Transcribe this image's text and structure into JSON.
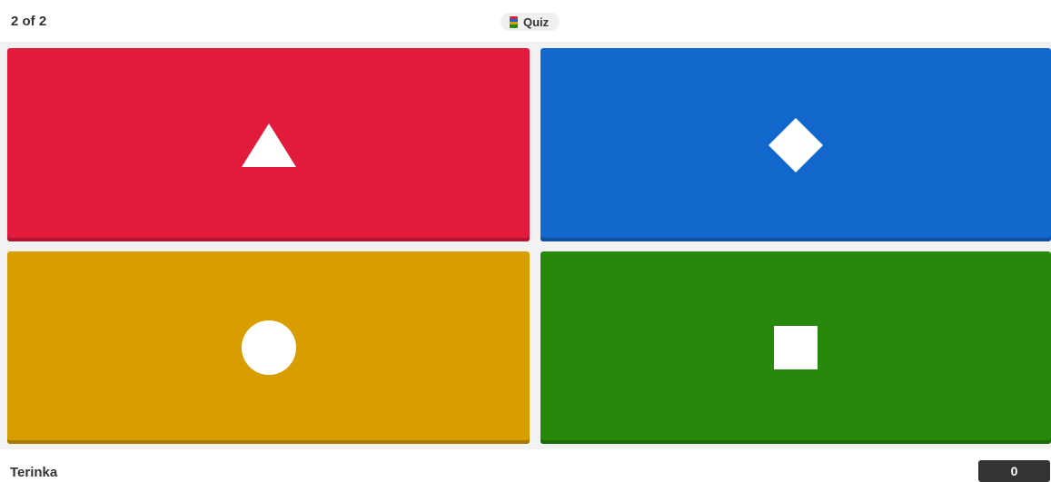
{
  "header": {
    "progress": "2 of 2",
    "question_type": "Quiz",
    "question_type_icon": "quiz-icon"
  },
  "answers": [
    {
      "color": "red",
      "shape": "triangle",
      "hex": "#e21b3c"
    },
    {
      "color": "blue",
      "shape": "diamond",
      "hex": "#1368ce"
    },
    {
      "color": "yellow",
      "shape": "circle",
      "hex": "#d89e00"
    },
    {
      "color": "green",
      "shape": "square",
      "hex": "#26890c"
    }
  ],
  "footer": {
    "player_name": "Terinka",
    "score": "0"
  }
}
